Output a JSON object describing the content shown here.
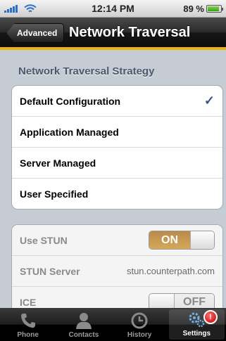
{
  "status_bar": {
    "time": "12:14 PM",
    "battery": "89 %",
    "battery_level": 0.89
  },
  "nav": {
    "back_label": "Advanced",
    "title": "Network Traversal"
  },
  "strategy": {
    "header": "Network Traversal Strategy",
    "options": [
      {
        "label": "Default Configuration",
        "selected": true
      },
      {
        "label": "Application Managed",
        "selected": false
      },
      {
        "label": "Server Managed",
        "selected": false
      },
      {
        "label": "User Specified",
        "selected": false
      }
    ],
    "check_glyph": "✓"
  },
  "settings": {
    "use_stun_label": "Use STUN",
    "use_stun_state": "ON",
    "stun_server_label": "STUN Server",
    "stun_server_value": "stun.counterpath.com",
    "ice_label": "ICE",
    "ice_state": "OFF"
  },
  "tabs": [
    {
      "label": "Phone",
      "icon": "phone-icon"
    },
    {
      "label": "Contacts",
      "icon": "contacts-icon"
    },
    {
      "label": "History",
      "icon": "history-icon"
    },
    {
      "label": "Settings",
      "icon": "settings-icon",
      "active": true,
      "badge": "!"
    }
  ],
  "colors": {
    "accent": "#e8b40e",
    "check": "#385487",
    "toggle_on": "#c79a55"
  }
}
